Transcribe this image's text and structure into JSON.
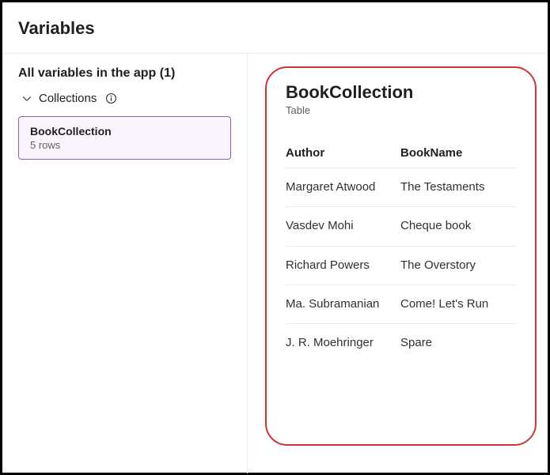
{
  "page_title": "Variables",
  "left": {
    "all_vars_label": "All variables in the app",
    "all_vars_count": "(1)",
    "collections_label": "Collections",
    "card": {
      "name": "BookCollection",
      "rows_label": "5 rows"
    }
  },
  "right": {
    "title": "BookCollection",
    "type_label": "Table",
    "columns": {
      "author": "Author",
      "bookname": "BookName"
    },
    "rows": [
      {
        "author": "Margaret Atwood",
        "bookname": "The Testaments"
      },
      {
        "author": "Vasdev Mohi",
        "bookname": "Cheque book"
      },
      {
        "author": "Richard Powers",
        "bookname": "The Overstory"
      },
      {
        "author": "Ma. Subramanian",
        "bookname": "Come! Let's Run"
      },
      {
        "author": "J. R. Moehringer",
        "bookname": "Spare"
      }
    ]
  },
  "colors": {
    "highlight_border": "#d13438",
    "card_border": "#8a60b4",
    "card_bg": "#fbf5ff"
  }
}
